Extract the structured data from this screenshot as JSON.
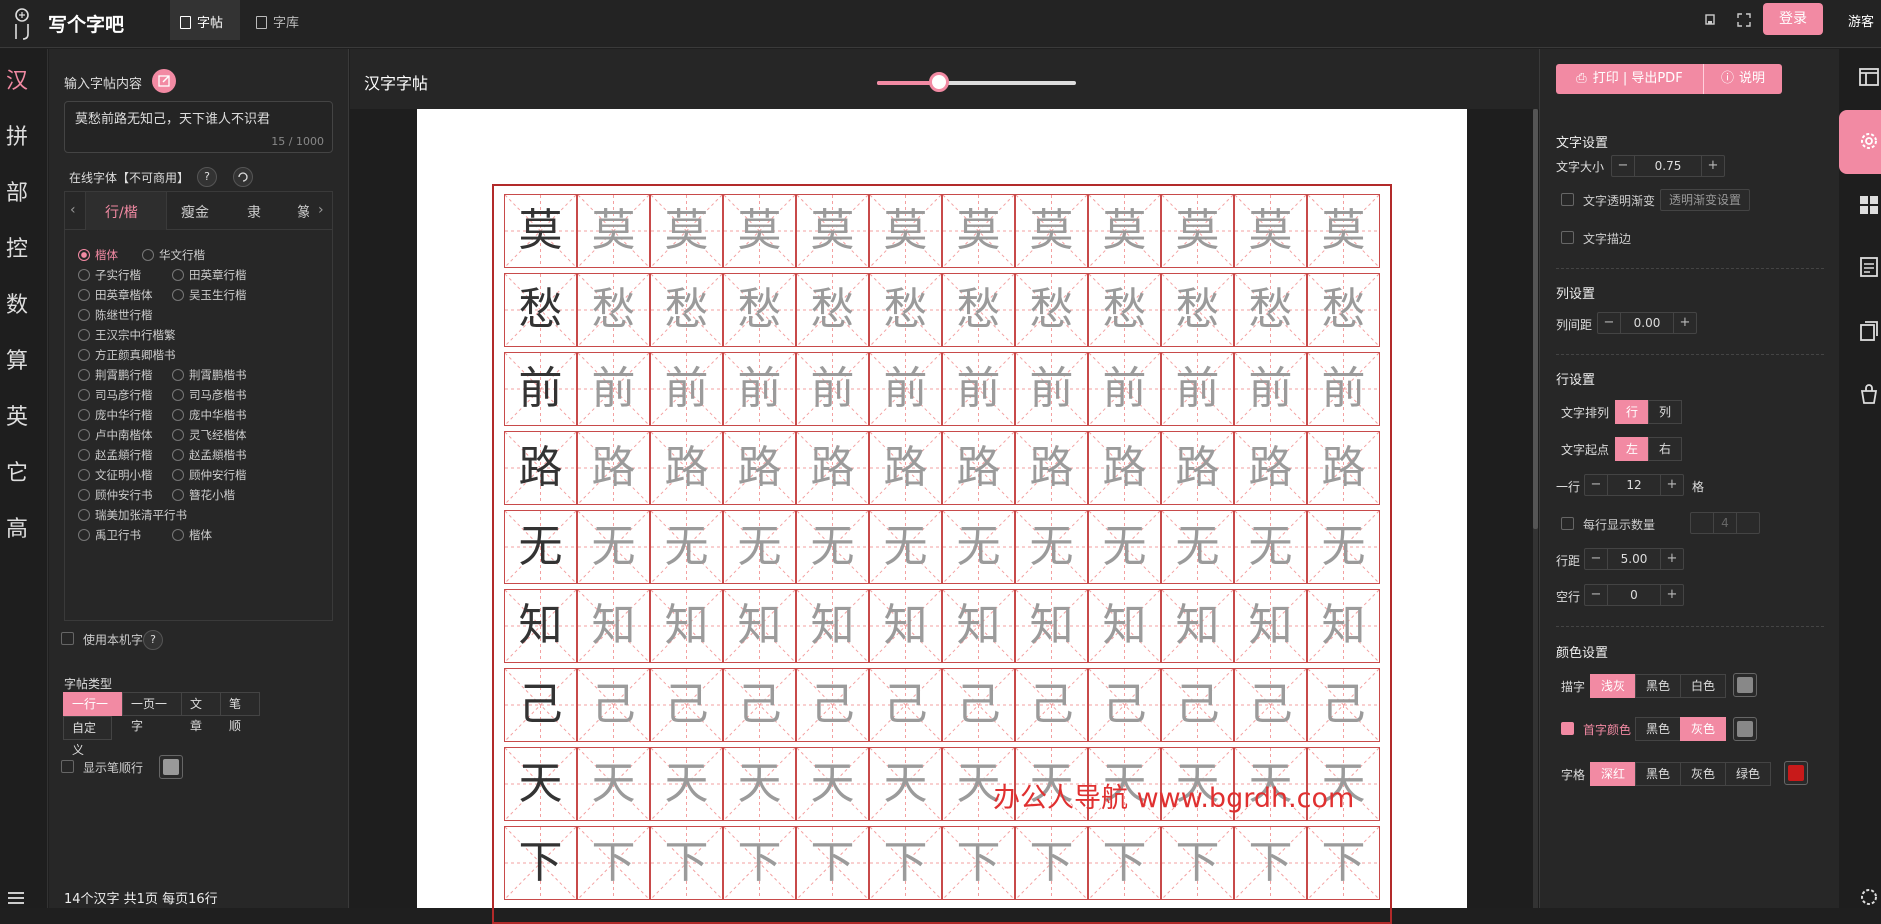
{
  "app": {
    "brand": "写个字吧"
  },
  "topbar": {
    "tabs": [
      {
        "label": "字帖"
      },
      {
        "label": "字库"
      }
    ],
    "login": "登录",
    "guest": "游客"
  },
  "leftnav": {
    "items": [
      "汉",
      "拼",
      "部",
      "控",
      "数",
      "算",
      "英",
      "它",
      "高"
    ]
  },
  "input": {
    "label": "输入字帖内容",
    "text": "莫愁前路无知己，天下谁人不识君",
    "counter": "15 / 1000"
  },
  "fonts": {
    "label": "在线字体【不可商用】",
    "help": "?",
    "tabs": [
      "行/楷",
      "瘦金",
      "隶",
      "篆"
    ],
    "options": [
      [
        "楷体",
        "华文行楷"
      ],
      [
        "子实行楷",
        "田英章行楷"
      ],
      [
        "田英章楷体",
        "吴玉生行楷"
      ],
      [
        "陈继世行楷"
      ],
      [
        "王汉宗中行楷繁"
      ],
      [
        "方正颜真卿楷书"
      ],
      [
        "荆霄鹏行楷",
        "荆霄鹏楷书"
      ],
      [
        "司马彦行楷",
        "司马彦楷书"
      ],
      [
        "庞中华行楷",
        "庞中华楷书"
      ],
      [
        "卢中南楷体",
        "灵飞经楷体"
      ],
      [
        "赵孟頫行楷",
        "赵孟頫楷书"
      ],
      [
        "文征明小楷",
        "顾仲安行楷"
      ],
      [
        "顾仲安行书",
        "簪花小楷"
      ],
      [
        "瑞美加张清平行书"
      ],
      [
        "禹卫行书",
        "楷体"
      ]
    ],
    "selected": "楷体",
    "local": "使用本机字体"
  },
  "copybook": {
    "label": "字帖类型",
    "types": [
      "一行一字",
      "一页一字",
      "文章",
      "笔顺",
      "自定义"
    ],
    "selected": "一行一字",
    "stroke_order": "显示笔顺行"
  },
  "footer": {
    "stats": "14个汉字 共1页 每页16行"
  },
  "center": {
    "title": "汉字字帖",
    "zoom": 0.31,
    "characters": [
      "莫",
      "愁",
      "前",
      "路",
      "无",
      "知",
      "己",
      "天",
      "下"
    ],
    "cells_per_row": 12,
    "watermark": "办公人导航 www.bgrdh.com"
  },
  "right": {
    "print": "打印 | 导出PDF",
    "help": "说明",
    "text_settings": {
      "title": "文字设置",
      "size_label": "文字大小",
      "size": "0.75",
      "gradient_label": "文字透明渐变",
      "gradient_btn": "透明渐变设置",
      "outline_label": "文字描边"
    },
    "col_settings": {
      "title": "列设置",
      "spacing_label": "列间距",
      "spacing": "0.00"
    },
    "row_settings": {
      "title": "行设置",
      "arrange_label": "文字排列",
      "arrange": [
        "行",
        "列"
      ],
      "start_label": "文字起点",
      "start": [
        "左",
        "右"
      ],
      "per_row_label": "一行",
      "per_row": "12",
      "per_row_unit": "格",
      "show_count_label": "每行显示数量",
      "show_count": "4",
      "row_gap_label": "行距",
      "row_gap": "5.00",
      "blank_label": "空行",
      "blank": "0"
    },
    "color_settings": {
      "title": "颜色设置",
      "trace_label": "描字",
      "trace": [
        "浅灰",
        "黑色",
        "白色"
      ],
      "trace_color": "#888888",
      "first_label": "首字颜色",
      "first": [
        "黑色",
        "灰色"
      ],
      "first_color": "#888888",
      "grid_label": "字格",
      "grid": [
        "深红",
        "黑色",
        "灰色",
        "绿色"
      ],
      "grid_color": "#c81a1a"
    }
  },
  "colors": {
    "accent": "#f28aa3",
    "grid_red": "#c84a4a",
    "guide_pink": "#f3a0a0"
  }
}
